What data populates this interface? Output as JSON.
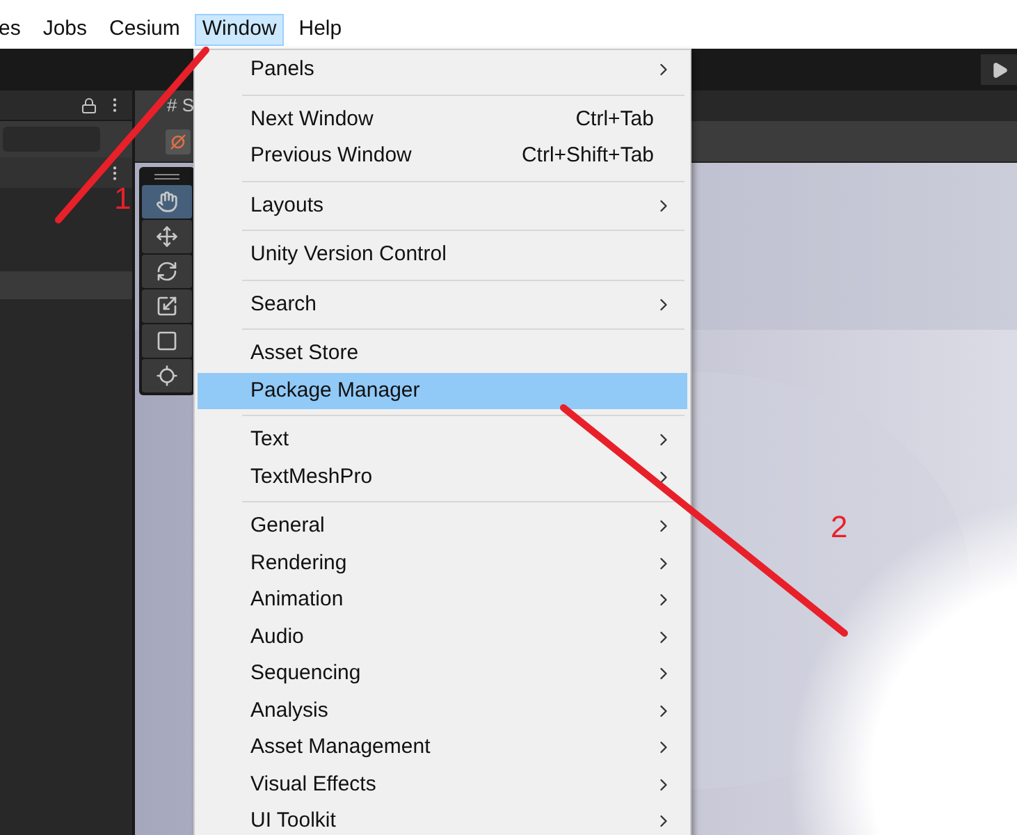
{
  "menu_bar": [
    {
      "label": "es",
      "selected": false
    },
    {
      "label": "Jobs",
      "selected": false
    },
    {
      "label": "Cesium",
      "selected": false
    },
    {
      "label": "Window",
      "selected": true
    },
    {
      "label": "Help",
      "selected": false
    }
  ],
  "hierarchy": {
    "rows": [
      {
        "selected": true
      }
    ]
  },
  "scene_tab": {
    "label": "# S"
  },
  "tools": [
    {
      "kind": "hand",
      "selected": true
    },
    {
      "kind": "move",
      "selected": false
    },
    {
      "kind": "rotate",
      "selected": false
    },
    {
      "kind": "scale",
      "selected": false
    },
    {
      "kind": "rect",
      "selected": false
    },
    {
      "kind": "transform",
      "selected": false
    }
  ],
  "window_menu": {
    "groups": [
      [
        {
          "label": "Panels",
          "submenu": true,
          "selected": false
        }
      ],
      [
        {
          "label": "Next Window",
          "shortcut": "Ctrl+Tab",
          "submenu": false,
          "selected": false
        },
        {
          "label": "Previous Window",
          "shortcut": "Ctrl+Shift+Tab",
          "submenu": false,
          "selected": false
        }
      ],
      [
        {
          "label": "Layouts",
          "submenu": true,
          "selected": false
        }
      ],
      [
        {
          "label": "Unity Version Control",
          "submenu": false,
          "selected": false
        }
      ],
      [
        {
          "label": "Search",
          "submenu": true,
          "selected": false
        }
      ],
      [
        {
          "label": "Asset Store",
          "submenu": false,
          "selected": false
        },
        {
          "label": "Package Manager",
          "submenu": false,
          "selected": true
        }
      ],
      [
        {
          "label": "Text",
          "submenu": true,
          "selected": false
        },
        {
          "label": "TextMeshPro",
          "submenu": true,
          "selected": false
        }
      ],
      [
        {
          "label": "General",
          "submenu": true,
          "selected": false
        },
        {
          "label": "Rendering",
          "submenu": true,
          "selected": false
        },
        {
          "label": "Animation",
          "submenu": true,
          "selected": false
        },
        {
          "label": "Audio",
          "submenu": true,
          "selected": false
        },
        {
          "label": "Sequencing",
          "submenu": true,
          "selected": false
        },
        {
          "label": "Analysis",
          "submenu": true,
          "selected": false
        },
        {
          "label": "Asset Management",
          "submenu": true,
          "selected": false
        },
        {
          "label": "Visual Effects",
          "submenu": true,
          "selected": false
        },
        {
          "label": "UI Toolkit",
          "submenu": true,
          "selected": false
        }
      ]
    ]
  },
  "annotations": [
    {
      "label": "1"
    },
    {
      "label": "2"
    }
  ]
}
